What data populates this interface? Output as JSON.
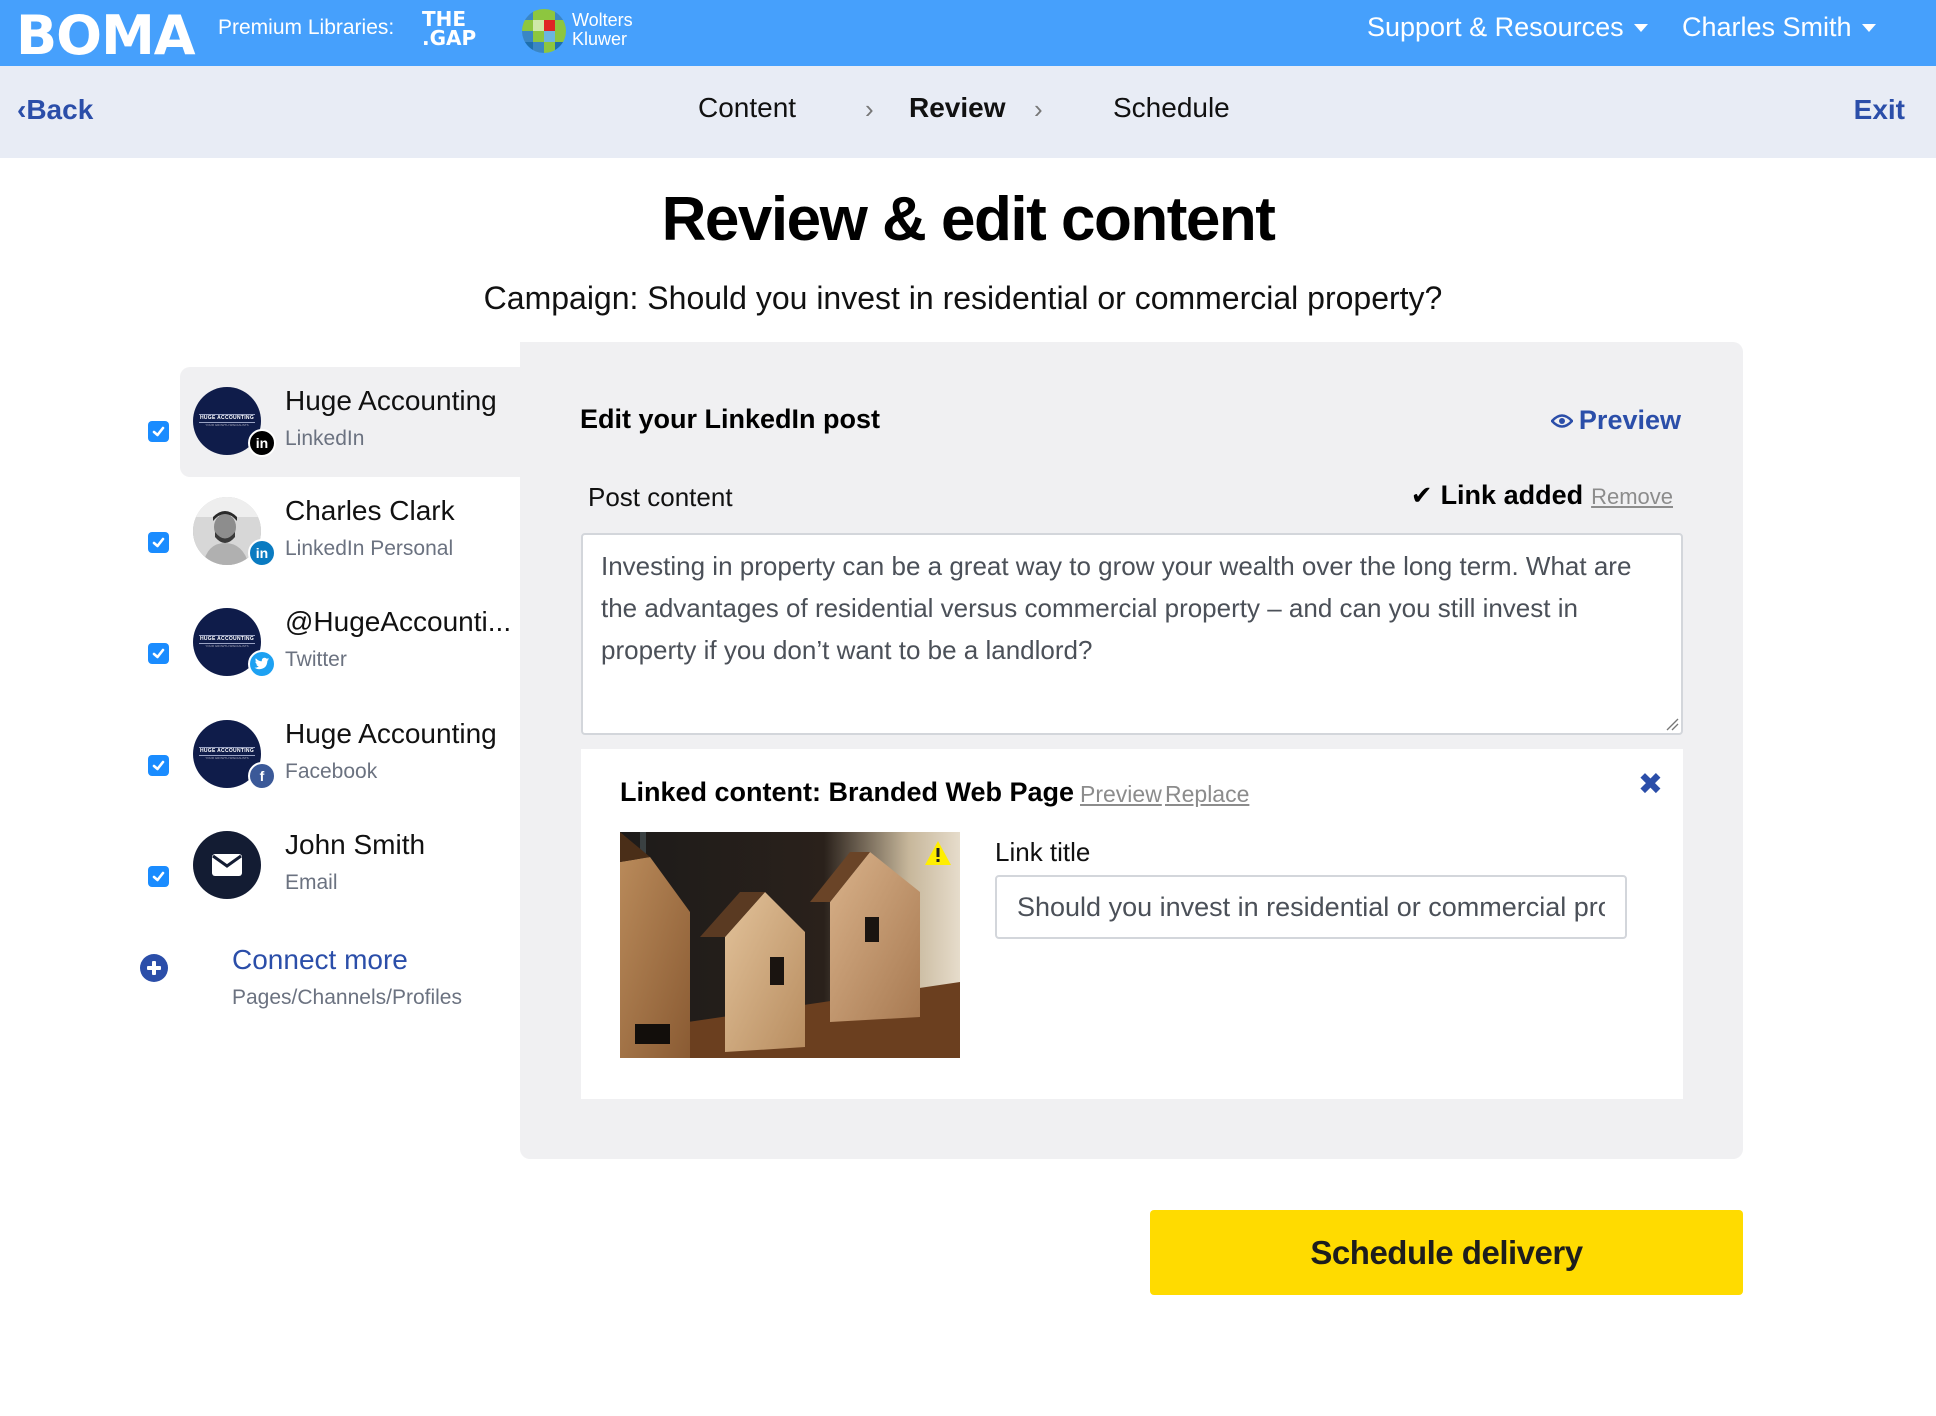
{
  "topbar": {
    "logo": "BOMA",
    "premium_label": "Premium Libraries:",
    "library_1": "THE\n.GAP",
    "library_1_line1": "THE",
    "library_1_line2": ".GAP",
    "library_2_line1": "Wolters",
    "library_2_line2": "Kluwer",
    "support_menu": "Support & Resources",
    "user_menu": "Charles Smith",
    "color": "#46a0fc"
  },
  "subnav": {
    "back": "Back",
    "back_glyph": "‹",
    "steps": [
      {
        "label": "Content",
        "active": false
      },
      {
        "label": "Review",
        "active": true
      },
      {
        "label": "Schedule",
        "active": false
      }
    ],
    "separator": "›",
    "exit": "Exit"
  },
  "page": {
    "title": "Review & edit content",
    "campaign": "Campaign: Should you invest in residential or commercial property?"
  },
  "accounts": [
    {
      "name": "Huge Accounting",
      "type": "LinkedIn",
      "checked": true,
      "active": true,
      "avatar": "huge-accounting-logo",
      "network_icon": "linkedin-icon",
      "badge_color": "#000000"
    },
    {
      "name": "Charles Clark",
      "type": "LinkedIn Personal",
      "checked": true,
      "active": false,
      "avatar": "profile-photo",
      "network_icon": "linkedin-icon",
      "badge_color": "#0a7bc1"
    },
    {
      "name": "@HugeAccounti...",
      "type": "Twitter",
      "checked": true,
      "active": false,
      "avatar": "huge-accounting-logo",
      "network_icon": "twitter-icon",
      "badge_color": "#1da1f2"
    },
    {
      "name": "Huge Accounting",
      "type": "Facebook",
      "checked": true,
      "active": false,
      "avatar": "huge-accounting-logo",
      "network_icon": "facebook-icon",
      "badge_color": "#3b5998"
    },
    {
      "name": "John Smith",
      "type": "Email",
      "checked": true,
      "active": false,
      "avatar": "email-icon",
      "network_icon": null,
      "badge_color": null
    }
  ],
  "avatar_brand": {
    "name": "HUGE ACCOUNTING",
    "tagline": "YOUR GROWTH SPECIALISTS"
  },
  "connect": {
    "label": "Connect more",
    "sub": "Pages/Channels/Profiles"
  },
  "editor": {
    "title": "Edit your LinkedIn post",
    "preview": "Preview",
    "post_label": "Post content",
    "link_status": "Link added",
    "remove": "Remove",
    "post_text": "Investing in property can be a great way to grow your wealth over the long term. What are the advantages of residential versus commercial property – and can you still invest in property if you don’t want to be a landlord?",
    "linked": {
      "title": "Linked content: Branded Web Page",
      "preview": "Preview",
      "replace": "Replace",
      "close": "✖",
      "image": "wooden-houses-photo",
      "image_warning": true,
      "link_title_label": "Link title",
      "link_title_value": "Should you invest in residential or commercial property?"
    }
  },
  "actions": {
    "schedule": "Schedule delivery",
    "schedule_color": "#ffdb00"
  },
  "colors": {
    "accent": "#2b4ea9",
    "panel": "#f0f0f2",
    "subnav": "#e8ecf5",
    "checkbox": "#1a8cff"
  }
}
